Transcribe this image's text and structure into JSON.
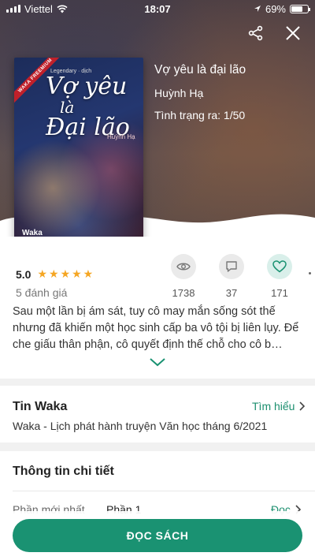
{
  "status_bar": {
    "carrier": "Viettel",
    "time": "18:07",
    "battery": "69%"
  },
  "header": {
    "share_icon": "share-icon",
    "close_icon": "close-icon"
  },
  "cover": {
    "badge": "WAKA FREEMIUM",
    "title_line1": "Vợ yêu",
    "title_line2": "là",
    "title_line3": "Đại lão",
    "subtitle": "Legendary · dịch",
    "author": "Huỳnh Hạ",
    "brand": "Waka"
  },
  "book": {
    "title": "Vợ yêu là đại lão",
    "author": "Huỳnh Hạ",
    "status": "Tình trạng ra: 1/50"
  },
  "rating": {
    "score": "5.0",
    "stars": 5,
    "count": "5 đánh giá"
  },
  "stats": {
    "views": "1738",
    "comments": "37",
    "likes": "171"
  },
  "description": "Sau một lần bị ám sát, tuy cô may mắn sống sót thế nhưng đã khiến một học sinh cấp ba vô tội bị liên lụy. Để che giấu thân phận, cô quyết định thế chỗ cho cô b…",
  "news": {
    "title": "Tin Waka",
    "link_label": "Tìm hiểu",
    "text": "Waka - Lịch phát hành truyện Văn học tháng 6/2021"
  },
  "details": {
    "title": "Thông tin chi tiết",
    "row_label": "Phần mới nhất",
    "row_value": "Phần 1",
    "row_link": "Đọc"
  },
  "read_button": "ĐỌC SÁCH",
  "colors": {
    "accent": "#1a9272",
    "star": "#f5a623"
  }
}
